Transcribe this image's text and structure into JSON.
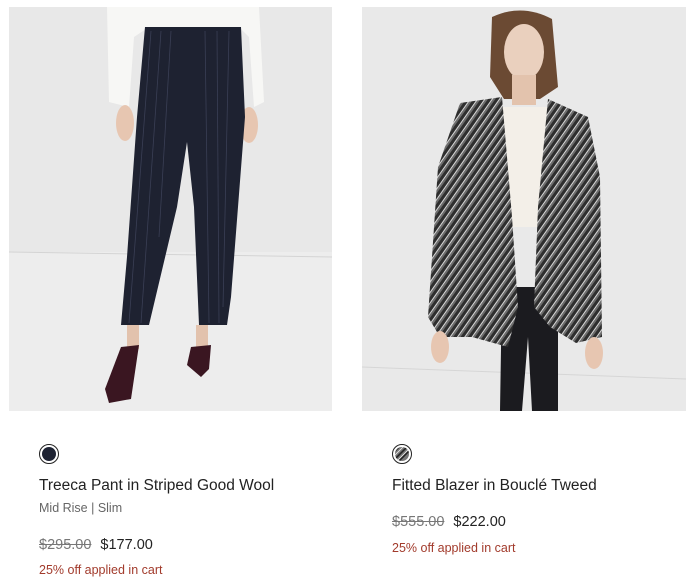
{
  "products": [
    {
      "name": "Treeca Pant in Striped Good Wool",
      "subtitle": "Mid Rise | Slim",
      "original_price": "$295.00",
      "sale_price": "$177.00",
      "promo": "25% off applied in cart",
      "swatch_color": "#1e2333",
      "image_icon": "striped-pant-photo"
    },
    {
      "name": "Fitted Blazer in Bouclé Tweed",
      "original_price": "$555.00",
      "sale_price": "$222.00",
      "promo": "25% off applied in cart",
      "swatch_color": "tweed-pattern",
      "image_icon": "tweed-blazer-photo"
    }
  ],
  "colors": {
    "promo_red": "#a23b2c",
    "strike_gray": "#777777"
  }
}
